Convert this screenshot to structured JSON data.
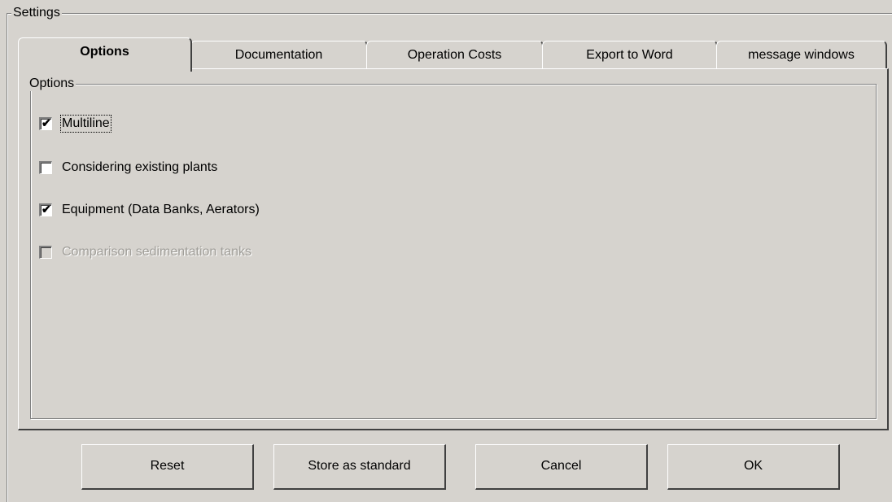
{
  "settings": {
    "title": "Settings"
  },
  "tabs": [
    {
      "label": "Options",
      "active": true
    },
    {
      "label": "Documentation",
      "active": false
    },
    {
      "label": "Operation Costs",
      "active": false
    },
    {
      "label": "Export to Word",
      "active": false
    },
    {
      "label": "message windows",
      "active": false
    }
  ],
  "options_group": {
    "title": "Options",
    "items": [
      {
        "label": "Multiline",
        "checked": true,
        "enabled": true
      },
      {
        "label": "Considering existing plants",
        "checked": false,
        "enabled": true
      },
      {
        "label": "Equipment (Data Banks, Aerators)",
        "checked": true,
        "enabled": true
      },
      {
        "label": "Comparison sedimentation tanks",
        "checked": false,
        "enabled": false
      }
    ]
  },
  "buttons": {
    "reset": "Reset",
    "store": "Store as standard",
    "cancel": "Cancel",
    "ok": "OK"
  },
  "check_glyph": "✔"
}
